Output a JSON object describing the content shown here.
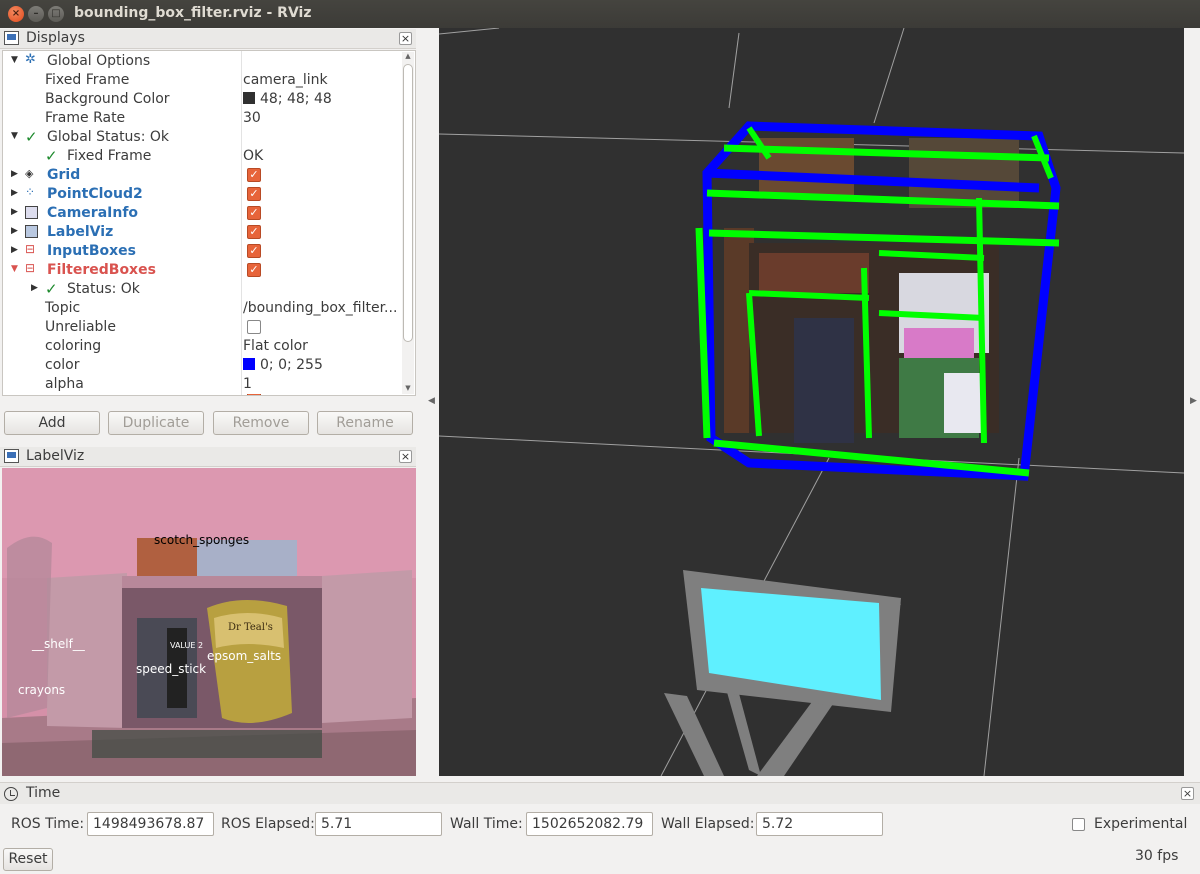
{
  "window": {
    "title": "bounding_box_filter.rviz - RViz"
  },
  "displays_panel": {
    "title": "Displays",
    "rows": [
      {
        "name": "Global Options",
        "value": ""
      },
      {
        "name": "Fixed Frame",
        "value": "camera_link"
      },
      {
        "name": "Background Color",
        "value": "48; 48; 48",
        "swatch": "#303030"
      },
      {
        "name": "Frame Rate",
        "value": "30"
      },
      {
        "name": "Global Status: Ok",
        "value": ""
      },
      {
        "name": "Fixed Frame",
        "value": "OK"
      },
      {
        "name": "Grid",
        "checked": true
      },
      {
        "name": "PointCloud2",
        "checked": true
      },
      {
        "name": "CameraInfo",
        "checked": true
      },
      {
        "name": "LabelViz",
        "checked": true
      },
      {
        "name": "InputBoxes",
        "checked": true
      },
      {
        "name": "FilteredBoxes",
        "checked": true
      },
      {
        "name": "Status: Ok",
        "value": ""
      },
      {
        "name": "Topic",
        "value": "/bounding_box_filter..."
      },
      {
        "name": "Unreliable",
        "checked": false
      },
      {
        "name": "coloring",
        "value": "Flat color"
      },
      {
        "name": "color",
        "value": "0; 0; 255",
        "swatch": "#0000ff"
      },
      {
        "name": "alpha",
        "value": "1"
      }
    ],
    "buttons": {
      "add": "Add",
      "duplicate": "Duplicate",
      "remove": "Remove",
      "rename": "Rename"
    }
  },
  "labelviz_panel": {
    "title": "LabelViz",
    "labels": {
      "scotch": "scotch_sponges",
      "shelf": "__shelf__",
      "epsom": "epsom_salts",
      "speed": "speed_stick",
      "crayons": "crayons",
      "stick_text": "VALUE 2",
      "bag_text": "Dr Teal's"
    }
  },
  "time_panel": {
    "title": "Time",
    "ros_time_label": "ROS Time:",
    "ros_time": "1498493678.87",
    "ros_elapsed_label": "ROS Elapsed:",
    "ros_elapsed": "5.71",
    "wall_time_label": "Wall Time:",
    "wall_time": "1502652082.79",
    "wall_elapsed_label": "Wall Elapsed:",
    "wall_elapsed": "5.72",
    "experimental_label": "Experimental",
    "reset_label": "Reset",
    "fps": "30 fps"
  },
  "colors": {
    "background": "#303030",
    "filtered_box": "#0000ff",
    "input_box": "#00ff00",
    "camera_frustum": "#7f7f7f",
    "camera_plane": "#5ff0ff",
    "checkbox": "#e7643a"
  }
}
